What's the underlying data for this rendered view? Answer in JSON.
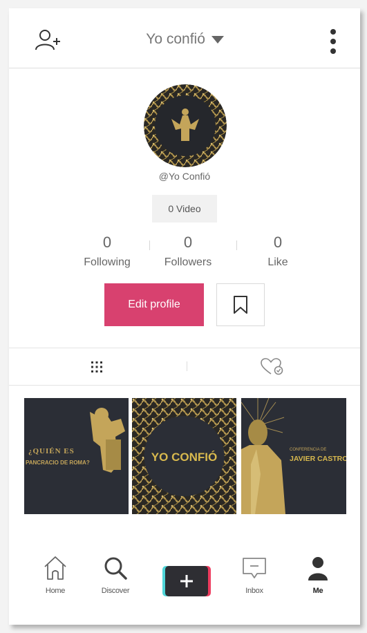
{
  "header": {
    "title": "Yo confió",
    "add_user_icon": "add-user-icon",
    "menu_icon": "vertical-dots-icon"
  },
  "profile": {
    "handle": "@Yo Confió",
    "video_count": "0 Video",
    "stats": [
      {
        "value": "0",
        "label": "Following"
      },
      {
        "value": "0",
        "label": "Followers"
      },
      {
        "value": "0",
        "label": "Like"
      }
    ],
    "edit_label": "Edit profile",
    "bookmark_icon": "bookmark-icon"
  },
  "tabs": [
    {
      "icon": "grid-icon"
    },
    {
      "icon": "liked-heart-icon"
    }
  ],
  "videos": [
    {
      "lines": [
        "¿QUIÉN ES",
        "PANCRACIO DE ROMA?"
      ]
    },
    {
      "lines": [
        "YO CONFIÓ"
      ]
    },
    {
      "lines": [
        "CONFERENCIA DE",
        "JAVIER CASTRO"
      ]
    }
  ],
  "nav": [
    {
      "label": "Home",
      "icon": "home-icon"
    },
    {
      "label": "Discover",
      "icon": "search-icon"
    },
    {
      "label": "",
      "icon": "plus-icon"
    },
    {
      "label": "Inbox",
      "icon": "message-icon"
    },
    {
      "label": "Me",
      "icon": "person-icon"
    }
  ],
  "colors": {
    "accent": "#d8416f",
    "gold": "#c4a55a",
    "dark": "#2a2c33",
    "create_cyan": "#4fd6d9",
    "create_red": "#ee3b5e"
  }
}
